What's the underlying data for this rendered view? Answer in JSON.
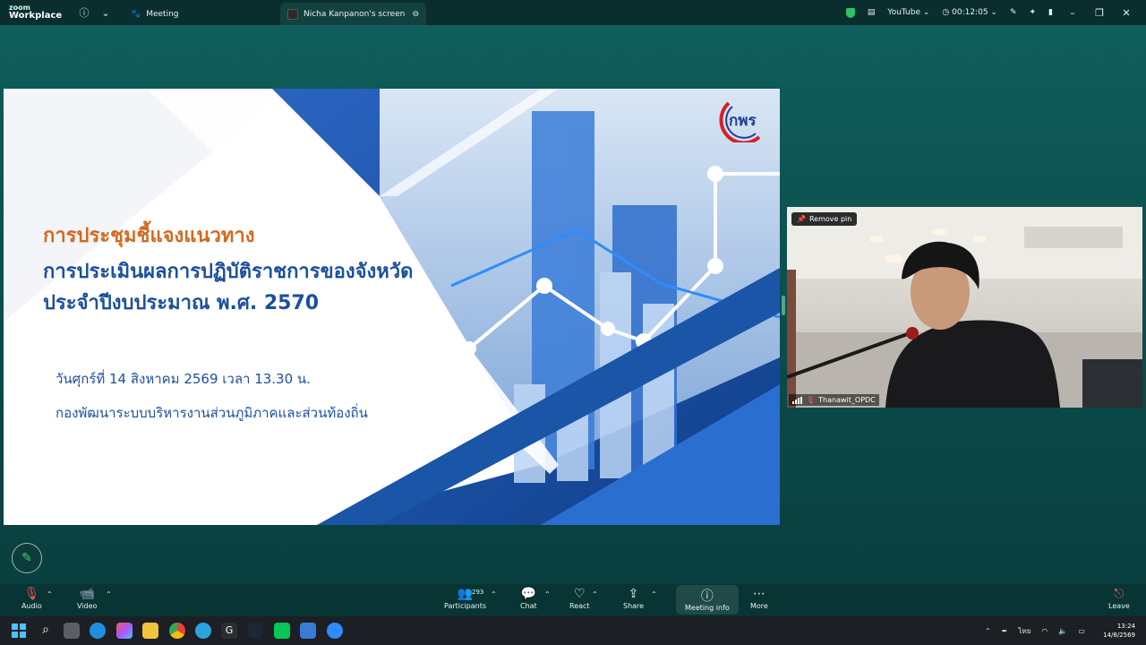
{
  "app": {
    "logo_line1": "zoom",
    "logo_line2": "Workplace"
  },
  "titlebar": {
    "tab_meeting": "Meeting",
    "tab_screen": "Nicha Kanpanon's screen",
    "youtube": "YouTube",
    "timer": "00:12:05"
  },
  "slide": {
    "line1": "การประชุมชี้แจงแนวทาง",
    "line2": "การประเมินผลการปฏิบัติราชการของจังหวัด",
    "line3": "ประจำปีงบประมาณ พ.ศ. 2570",
    "date_line": "วันศุกร์ที่ 14 สิงหาคม 2569 เวลา 13.30 น.",
    "org_line": "กองพัฒนาระบบบริหารงานส่วนภูมิภาคและส่วนท้องถิ่น",
    "brand": "กพร",
    "colors": {
      "title_orange": "#d2691e",
      "title_blue": "#1c4f9e",
      "dark_blue": "#1a55a8"
    }
  },
  "video": {
    "pin_label": "Remove pin",
    "participant_name": "Thanawit_OPDC"
  },
  "toolbar": {
    "audio": "Audio",
    "video": "Video",
    "participants": "Participants",
    "participants_count": "293",
    "chat": "Chat",
    "react": "React",
    "share": "Share",
    "meeting_info": "Meeting info",
    "more": "More",
    "leave": "Leave"
  },
  "taskbar": {
    "lang": "ไทย",
    "time": "13:24",
    "date": "14/8/2569"
  }
}
